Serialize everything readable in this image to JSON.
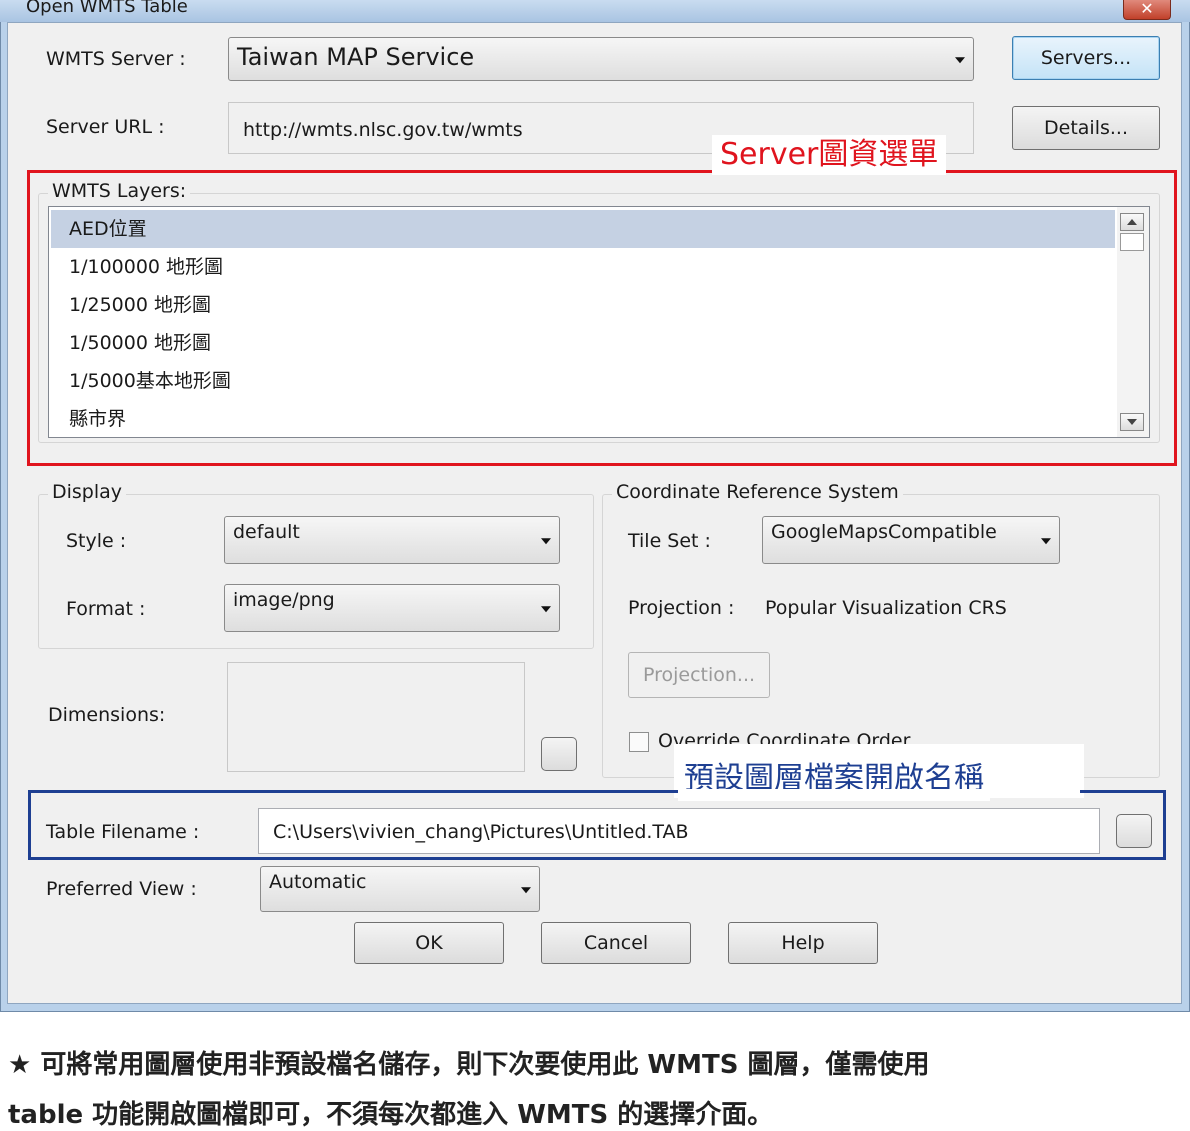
{
  "window": {
    "title": "Open WMTS Table",
    "close_glyph": "✕"
  },
  "server": {
    "label": "WMTS Server :",
    "value": "Taiwan MAP Service",
    "servers_button": "Servers...",
    "url_label": "Server URL :",
    "url_value": "http://wmts.nlsc.gov.tw/wmts",
    "details_button": "Details..."
  },
  "layers": {
    "legend": "WMTS Layers:",
    "items": [
      "AED位置",
      "1/100000 地形圖",
      "1/25000 地形圖",
      "1/50000 地形圖",
      "1/5000基本地形圖",
      "縣市界"
    ],
    "selected_index": 0
  },
  "display": {
    "legend": "Display",
    "style_label": "Style :",
    "style_value": "default",
    "format_label": "Format :",
    "format_value": "image/png",
    "dimensions_label": "Dimensions:"
  },
  "crs": {
    "legend": "Coordinate Reference System",
    "tileset_label": "Tile Set :",
    "tileset_value": "GoogleMapsCompatible",
    "projection_label": "Projection :",
    "projection_value": "Popular Visualization CRS",
    "projection_button": "Projection...",
    "override_label": "Override Coordinate Order"
  },
  "table": {
    "label": "Table Filename :",
    "value": "C:\\Users\\vivien_chang\\Pictures\\Untitled.TAB"
  },
  "view": {
    "label": "Preferred View :",
    "value": "Automatic"
  },
  "buttons": {
    "ok": "OK",
    "cancel": "Cancel",
    "help": "Help"
  },
  "annotations": {
    "server_menu": "Server圖資選單",
    "default_filename": "預設圖層檔案開啟名稱",
    "red_color": "#e0141e",
    "blue_color": "#1e3f92"
  },
  "note": {
    "line1": "★ 可將常用圖層使用非預設檔名儲存，則下次要使用此 WMTS 圖層，僅需使用",
    "line2": "table 功能開啟圖檔即可，不須每次都進入 WMTS 的選擇介面。"
  }
}
